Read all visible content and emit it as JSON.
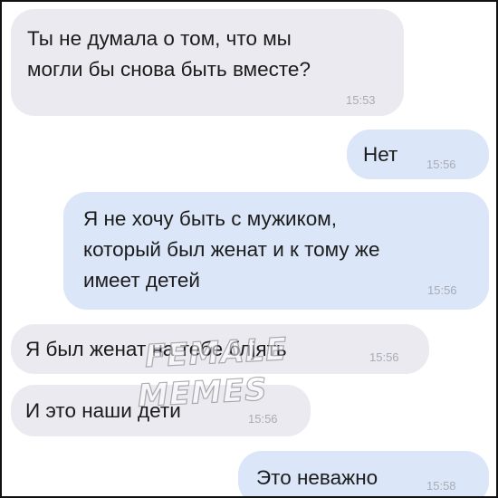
{
  "messages": [
    {
      "direction": "incoming",
      "lines": [
        "Ты не думала о том, что мы",
        "могли бы снова быть вместе?"
      ],
      "time": "15:53"
    },
    {
      "direction": "outgoing",
      "lines": [
        "Нет"
      ],
      "time": "15:56"
    },
    {
      "direction": "outgoing",
      "lines": [
        "Я не хочу быть с мужиком,",
        "который был женат и к тому же",
        "имеет детей"
      ],
      "time": "15:56"
    },
    {
      "direction": "incoming",
      "lines": [
        "Я был женат на тебе блјять"
      ],
      "time": "15:56"
    },
    {
      "direction": "incoming",
      "lines": [
        "И это наши дети"
      ],
      "time": "15:56"
    },
    {
      "direction": "outgoing",
      "lines": [
        "Это неважно"
      ],
      "time": "15:58"
    }
  ],
  "watermark": {
    "line1": "FEMALE",
    "line2": "MEMES"
  },
  "colors": {
    "incoming_bubble": "#eaeaf0",
    "outgoing_bubble": "#dbe6f8",
    "text": "#1c1c1c",
    "time": "#a9acb6"
  }
}
